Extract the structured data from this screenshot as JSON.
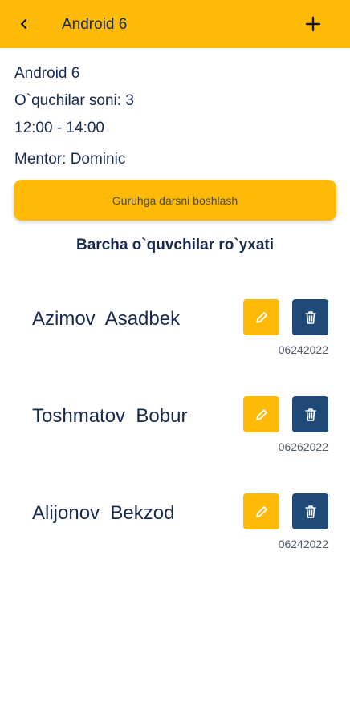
{
  "app_bar": {
    "title": "Android 6",
    "back_icon": "back-arrow-icon",
    "add_icon": "plus-icon",
    "color": "#FFBA08"
  },
  "group": {
    "name": "Android 6",
    "students_count": "O`quchilar soni: 3",
    "time": "12:00 - 14:00",
    "mentor": "Mentor: Dominic"
  },
  "start_button": {
    "label": "Guruhga darsni boshlash"
  },
  "list": {
    "heading": "Barcha o`quvchilar ro`yxati",
    "students": [
      {
        "name": "Azimov  Asadbek",
        "date": "06242022"
      },
      {
        "name": "Toshmatov  Bobur",
        "date": "06262022"
      },
      {
        "name": "Alijonov  Bekzod",
        "date": "06242022"
      }
    ]
  },
  "colors": {
    "accent": "#FFBA08",
    "text_dark": "#16294f",
    "delete_button": "#1f4a78"
  }
}
